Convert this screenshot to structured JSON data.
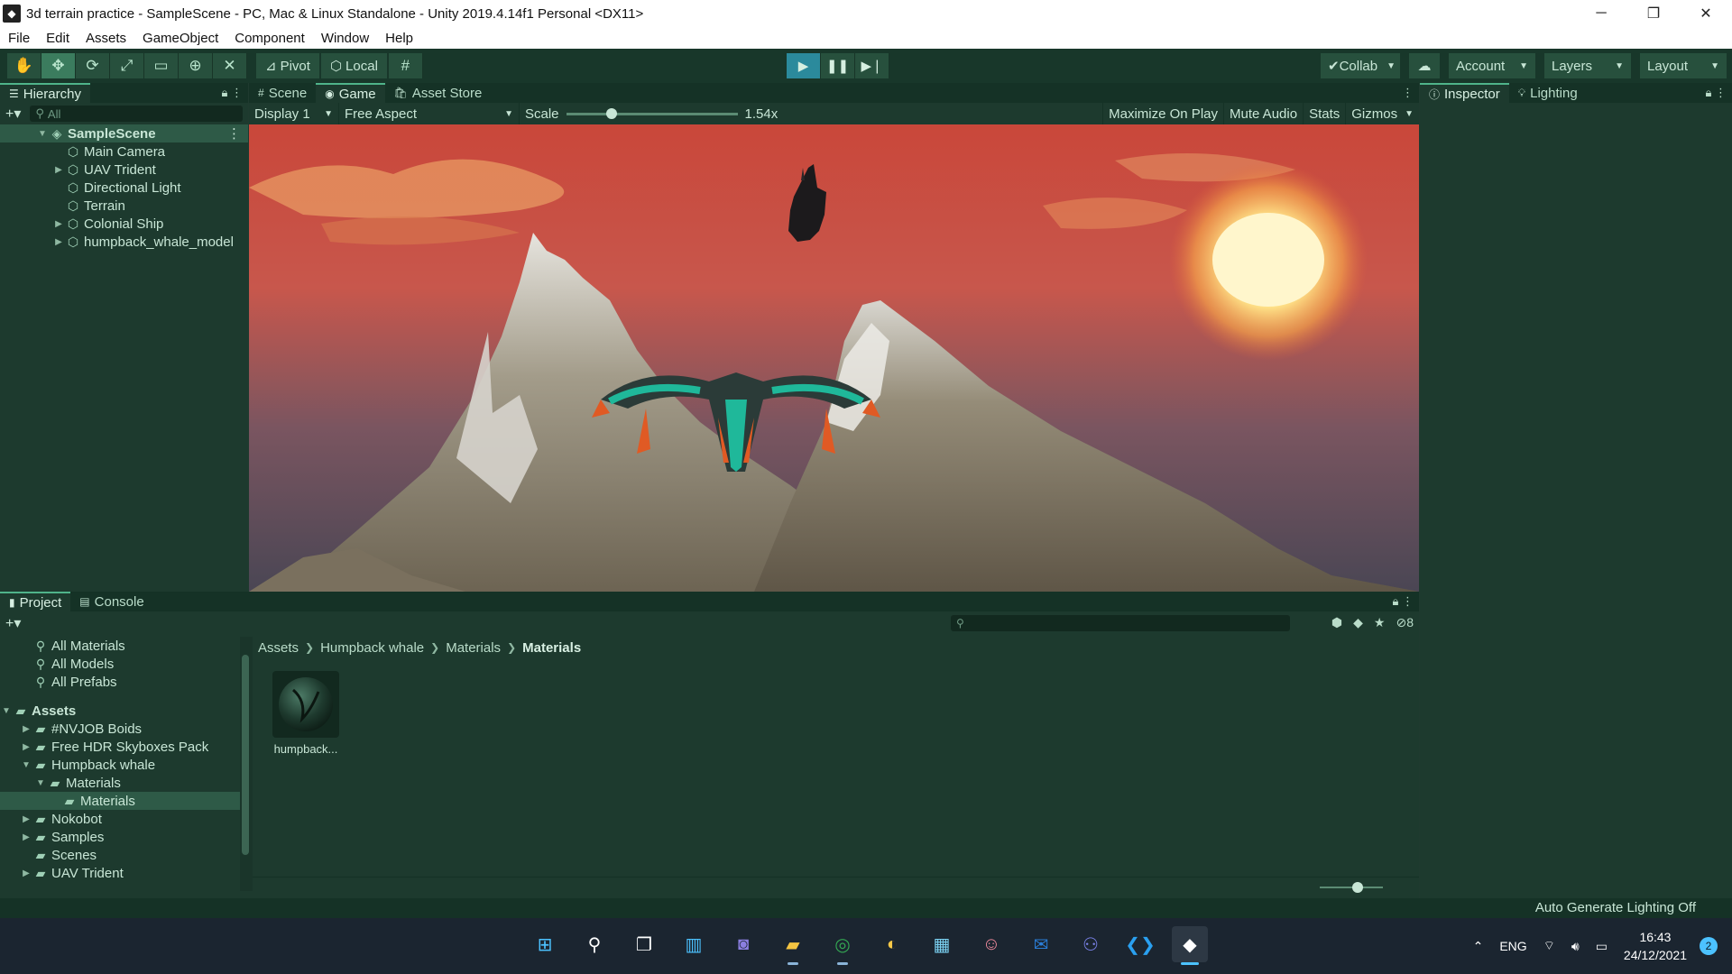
{
  "window": {
    "title": "3d terrain practice - SampleScene - PC, Mac & Linux Standalone - Unity 2019.4.14f1 Personal <DX11>",
    "controls": [
      "─",
      "❐",
      "✕"
    ]
  },
  "menu": [
    "File",
    "Edit",
    "Assets",
    "GameObject",
    "Component",
    "Window",
    "Help"
  ],
  "toolbar": {
    "pivot_label": "Pivot",
    "local_label": "Local",
    "collab_label": "Collab",
    "account_label": "Account",
    "layers_label": "Layers",
    "layout_label": "Layout"
  },
  "hierarchy": {
    "tab_label": "Hierarchy",
    "search_placeholder": "All",
    "scene_name": "SampleScene",
    "items": [
      {
        "label": "Main Camera",
        "expandable": false
      },
      {
        "label": "UAV Trident",
        "expandable": true
      },
      {
        "label": "Directional Light",
        "expandable": false
      },
      {
        "label": "Terrain",
        "expandable": false
      },
      {
        "label": "Colonial Ship",
        "expandable": true
      },
      {
        "label": "humpback_whale_model",
        "expandable": true
      }
    ]
  },
  "views": {
    "tabs": [
      "Scene",
      "Game",
      "Asset Store"
    ],
    "active_tab": "Game",
    "display": "Display 1",
    "aspect": "Free Aspect",
    "scale_label": "Scale",
    "scale_value": "1.54x",
    "maximize_label": "Maximize On Play",
    "mute_label": "Mute Audio",
    "stats_label": "Stats",
    "gizmos_label": "Gizmos"
  },
  "inspector": {
    "tabs": [
      "Inspector",
      "Lighting"
    ]
  },
  "project": {
    "tabs": [
      "Project",
      "Console"
    ],
    "hidden_count": "8",
    "favorites": [
      "All Materials",
      "All Models",
      "All Prefabs"
    ],
    "assets_root": "Assets",
    "folders": [
      {
        "label": "#NVJOB Boids",
        "depth": 1,
        "arrow": "▶",
        "selected": false
      },
      {
        "label": "Free HDR Skyboxes Pack",
        "depth": 1,
        "arrow": "▶",
        "selected": false
      },
      {
        "label": "Humpback whale",
        "depth": 1,
        "arrow": "▼",
        "selected": false
      },
      {
        "label": "Materials",
        "depth": 2,
        "arrow": "▼",
        "selected": false
      },
      {
        "label": "Materials",
        "depth": 3,
        "arrow": "",
        "selected": true
      },
      {
        "label": "Nokobot",
        "depth": 1,
        "arrow": "▶",
        "selected": false
      },
      {
        "label": "Samples",
        "depth": 1,
        "arrow": "▶",
        "selected": false
      },
      {
        "label": "Scenes",
        "depth": 1,
        "arrow": "",
        "selected": false
      },
      {
        "label": "UAV Trident",
        "depth": 1,
        "arrow": "▶",
        "selected": false
      }
    ],
    "breadcrumb": [
      "Assets",
      "Humpback whale",
      "Materials",
      "Materials"
    ],
    "assets": [
      {
        "label": "humpback..."
      }
    ]
  },
  "status": {
    "text": "Auto Generate Lighting Off"
  },
  "taskbar": {
    "language": "ENG",
    "time": "16:43",
    "date": "24/12/2021",
    "notifications": "2"
  },
  "colors": {
    "editor_bg": "#1d3a2e",
    "accent": "#4fb38a",
    "play_active": "#2b8a9c",
    "taskbar": "#1b2530"
  }
}
